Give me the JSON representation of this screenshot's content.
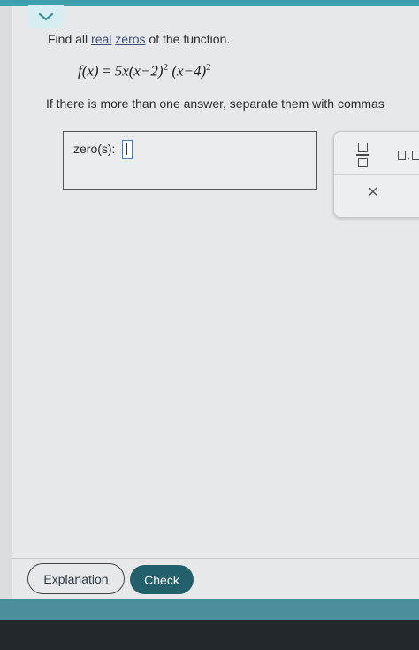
{
  "question": {
    "prefix": "Find all ",
    "link_real": "real",
    "link_zeros": "zeros",
    "suffix": " of the function."
  },
  "equation": {
    "lhs": "f(x)",
    "equals": "=",
    "factor1": "5x",
    "factor2": "(x−2)",
    "exp2": "2",
    "factor3": "(x−4)",
    "exp3": "2"
  },
  "instruction": "If there is more than one answer, separate them with commas",
  "answer": {
    "label": "zero(s):",
    "value": ""
  },
  "tools": {
    "fraction_icon": "fraction-icon",
    "mixed_icon": "comma-list-icon",
    "clear_label": "×"
  },
  "footer": {
    "explanation_label": "Explanation",
    "check_label": "Check"
  },
  "colors": {
    "accent": "#3fa0ad",
    "check_button": "#23606b",
    "input_border": "#3a7fd2"
  }
}
